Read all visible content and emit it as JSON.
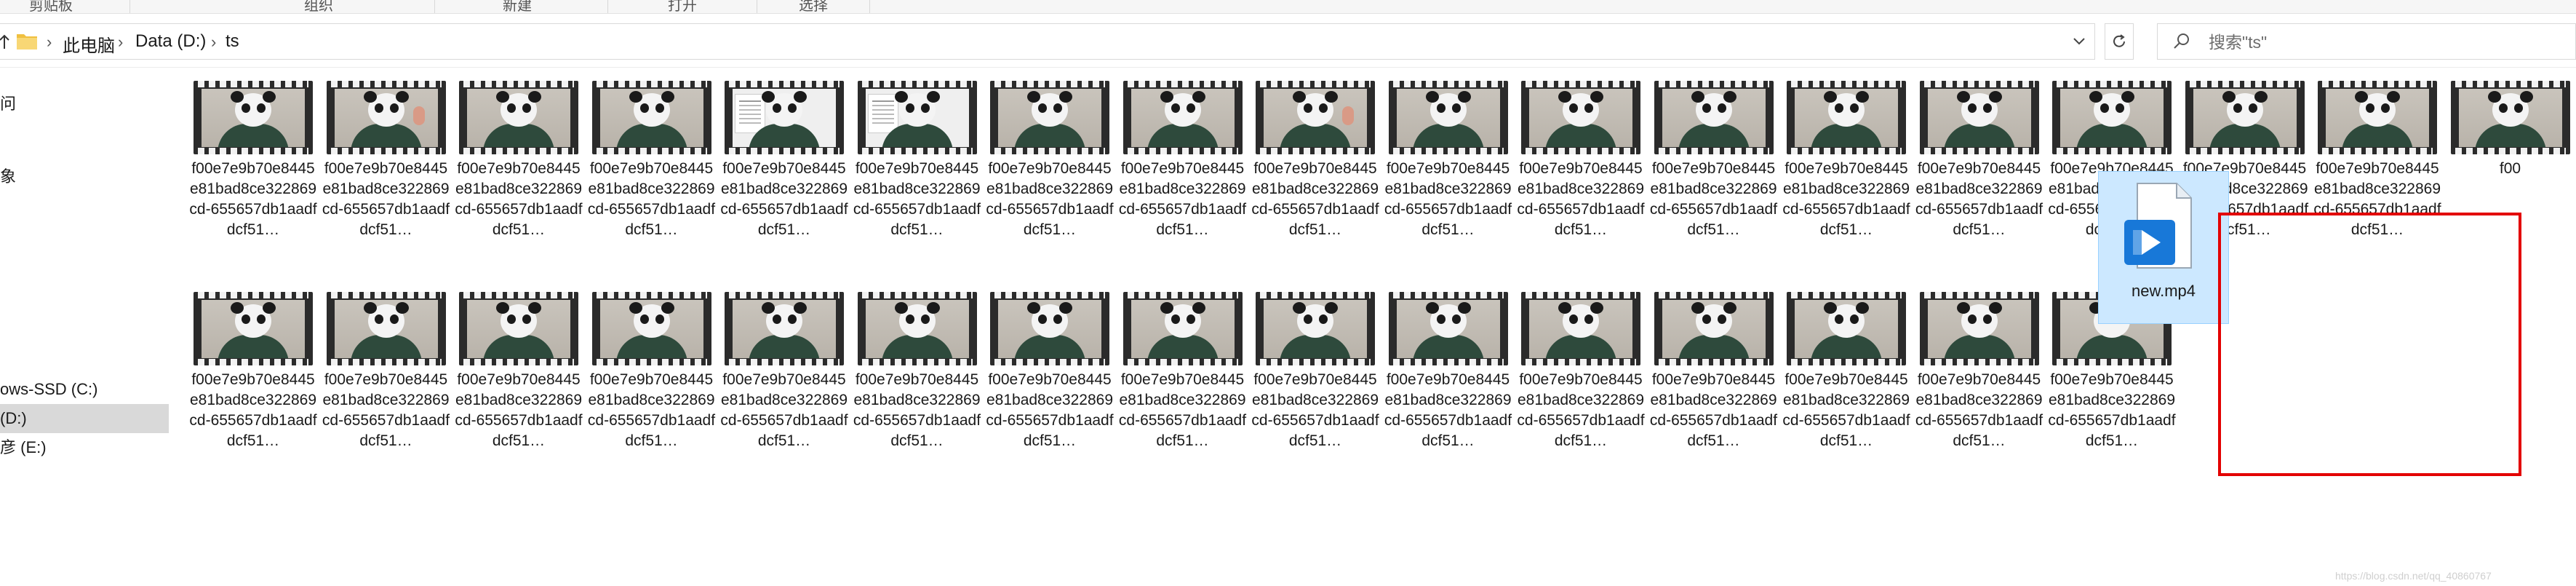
{
  "ribbon": {
    "groups": [
      "剪贴板",
      "组织",
      "新建",
      "打开",
      "选择"
    ]
  },
  "address_bar": {
    "up_icon": "up-arrow-icon",
    "folder_icon": "folder-icon",
    "crumbs": [
      "此电脑",
      "Data (D:)",
      "ts"
    ],
    "dropdown_icon": "chevron-down-icon",
    "refresh_icon": "refresh-icon"
  },
  "search": {
    "placeholder": "搜索\"ts\""
  },
  "nav_pane": {
    "items": [
      {
        "label": "问",
        "selected": false
      },
      {
        "label": "象",
        "selected": false
      },
      {
        "label": "ows-SSD (C:)",
        "selected": false
      },
      {
        "label": "(D:)",
        "selected": true
      },
      {
        "label": "彦 (E:)",
        "selected": false
      }
    ]
  },
  "files": {
    "truncated_name": "f00e7e9b70e8445e81bad8ce322869cd-655657db1aadfdcf51…",
    "row1": [
      {
        "label": "f00e7e9b70e8445e81bad8ce322869cd-655657db1aadfdcf51…",
        "thumb": "panda"
      },
      {
        "label": "f00e7e9b70e8445e81bad8ce322869cd-655657db1aadfdcf51…",
        "thumb": "panda-hand"
      },
      {
        "label": "f00e7e9b70e8445e81bad8ce322869cd-655657db1aadfdcf51…",
        "thumb": "panda"
      },
      {
        "label": "f00e7e9b70e8445e81bad8ce322869cd-655657db1aadfdcf51…",
        "thumb": "panda"
      },
      {
        "label": "f00e7e9b70e8445e81bad8ce322869cd-655657db1aadfdcf51…",
        "thumb": "panda-doc"
      },
      {
        "label": "f00e7e9b70e8445e81bad8ce322869cd-655657db1aadfdcf51…",
        "thumb": "panda-doc"
      },
      {
        "label": "f00e7e9b70e8445e81bad8ce322869cd-655657db1aadfdcf51…",
        "thumb": "panda"
      },
      {
        "label": "f00e7e9b70e8445e81bad8ce322869cd-655657db1aadfdcf51…",
        "thumb": "panda"
      },
      {
        "label": "f00e7e9b70e8445e81bad8ce322869cd-655657db1aadfdcf51…",
        "thumb": "panda-hand"
      },
      {
        "label": "f00e7e9b70e8445e81bad8ce322869cd-655657db1aadfdcf51…",
        "thumb": "panda"
      },
      {
        "label": "f00e7e9b70e8445e81bad8ce322869cd-655657db1aadfdcf51…",
        "thumb": "panda"
      },
      {
        "label": "f00e7e9b70e8445e81bad8ce322869cd-655657db1aadfdcf51…",
        "thumb": "panda"
      },
      {
        "label": "f00e7e9b70e8445e81bad8ce322869cd-655657db1aadfdcf51…",
        "thumb": "panda"
      },
      {
        "label": "f00e7e9b70e8445e81bad8ce322869cd-655657db1aadfdcf51…",
        "thumb": "panda"
      },
      {
        "label": "f00e7e9b70e8445e81bad8ce322869cd-655657db1aadfdcf51…",
        "thumb": "panda"
      },
      {
        "label": "f00e7e9b70e8445e81bad8ce322869cd-655657db1aadfdcf51…",
        "thumb": "panda"
      },
      {
        "label": "f00e7e9b70e8445e81bad8ce322869cd-655657db1aadfdcf51…",
        "thumb": "panda"
      },
      {
        "label": "f00",
        "thumb": "panda"
      }
    ],
    "row2": [
      {
        "label": "f00e7e9b70e8445e81bad8ce322869cd-655657db1aadfdcf51…",
        "thumb": "panda"
      },
      {
        "label": "f00e7e9b70e8445e81bad8ce322869cd-655657db1aadfdcf51…",
        "thumb": "panda"
      },
      {
        "label": "f00e7e9b70e8445e81bad8ce322869cd-655657db1aadfdcf51…",
        "thumb": "panda"
      },
      {
        "label": "f00e7e9b70e8445e81bad8ce322869cd-655657db1aadfdcf51…",
        "thumb": "panda"
      },
      {
        "label": "f00e7e9b70e8445e81bad8ce322869cd-655657db1aadfdcf51…",
        "thumb": "panda"
      },
      {
        "label": "f00e7e9b70e8445e81bad8ce322869cd-655657db1aadfdcf51…",
        "thumb": "panda"
      },
      {
        "label": "f00e7e9b70e8445e81bad8ce322869cd-655657db1aadfdcf51…",
        "thumb": "panda"
      },
      {
        "label": "f00e7e9b70e8445e81bad8ce322869cd-655657db1aadfdcf51…",
        "thumb": "panda"
      },
      {
        "label": "f00e7e9b70e8445e81bad8ce322869cd-655657db1aadfdcf51…",
        "thumb": "panda"
      },
      {
        "label": "f00e7e9b70e8445e81bad8ce322869cd-655657db1aadfdcf51…",
        "thumb": "panda"
      },
      {
        "label": "f00e7e9b70e8445e81bad8ce322869cd-655657db1aadfdcf51…",
        "thumb": "panda"
      },
      {
        "label": "f00e7e9b70e8445e81bad8ce322869cd-655657db1aadfdcf51…",
        "thumb": "panda"
      },
      {
        "label": "f00e7e9b70e8445e81bad8ce322869cd-655657db1aadfdcf51…",
        "thumb": "panda"
      },
      {
        "label": "f00e7e9b70e8445e81bad8ce322869cd-655657db1aadfdcf51…",
        "thumb": "panda"
      },
      {
        "label": "f00e7e9b70e8445e81bad8ce322869cd-655657db1aadfdcf51…",
        "thumb": "panda"
      }
    ],
    "new_file": {
      "label": "new.mp4",
      "icon": "video-file-icon",
      "selected": true
    }
  },
  "annotation": {
    "highlight_color": "#e30000"
  },
  "watermark": "https://blog.csdn.net/qq_40860767",
  "colors": {
    "selection_bg": "#cce8ff",
    "selection_border": "#99d1ff",
    "nav_selected": "#d9d9d9",
    "file_icon_blue": "#1878d8"
  }
}
